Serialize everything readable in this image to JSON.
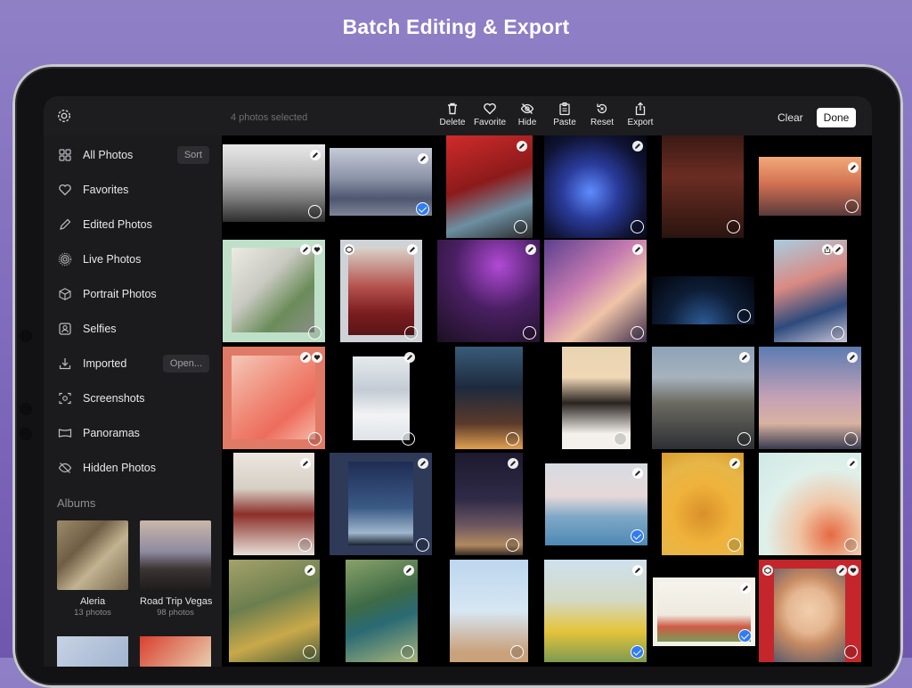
{
  "headline": "Batch Editing & Export",
  "topbar": {
    "selection_status": "4 photos selected",
    "tools": [
      {
        "label": "Delete",
        "icon": "trash-icon"
      },
      {
        "label": "Favorite",
        "icon": "heart-icon"
      },
      {
        "label": "Hide",
        "icon": "eye-slash-icon"
      },
      {
        "label": "Paste",
        "icon": "clipboard-icon"
      },
      {
        "label": "Reset",
        "icon": "reset-icon"
      },
      {
        "label": "Export",
        "icon": "share-icon"
      }
    ],
    "clear_label": "Clear",
    "done_label": "Done"
  },
  "sidebar": {
    "items": [
      {
        "label": "All Photos",
        "icon": "grid-icon",
        "action": "Sort"
      },
      {
        "label": "Favorites",
        "icon": "heart-icon"
      },
      {
        "label": "Edited Photos",
        "icon": "pencil-icon"
      },
      {
        "label": "Live Photos",
        "icon": "live-photo-icon"
      },
      {
        "label": "Portrait Photos",
        "icon": "cube-icon"
      },
      {
        "label": "Selfies",
        "icon": "person-square-icon"
      },
      {
        "label": "Imported",
        "icon": "download-icon",
        "action": "Open..."
      },
      {
        "label": "Screenshots",
        "icon": "screenshot-icon"
      },
      {
        "label": "Panoramas",
        "icon": "panorama-icon"
      },
      {
        "label": "Hidden Photos",
        "icon": "eye-slash-icon"
      }
    ],
    "albums_heading": "Albums",
    "albums": [
      {
        "name": "Aleria",
        "count": "13 photos"
      },
      {
        "name": "Road Trip Vegas",
        "count": "98 photos"
      }
    ]
  },
  "colors": {
    "selection_accent": "#2f7cf6",
    "done_bg": "#ffffff",
    "background_gradient_top": "#8f80c6"
  }
}
